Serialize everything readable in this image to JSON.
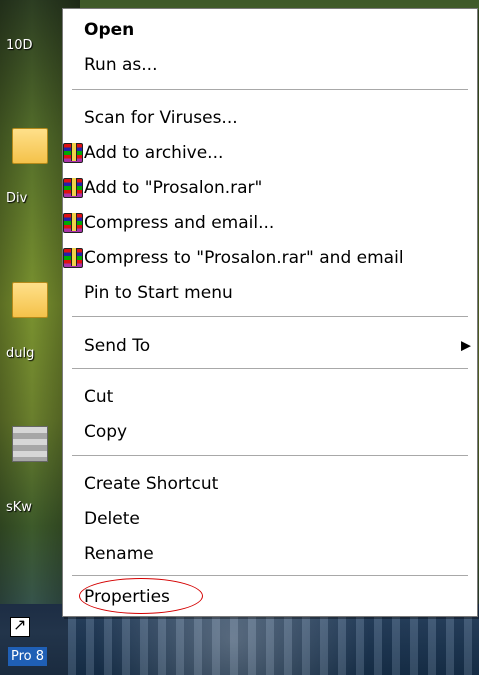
{
  "desktop": {
    "labels": [
      "10D",
      "Div",
      "dulg",
      "sKw",
      "Pro 8"
    ]
  },
  "context_menu": {
    "items": [
      {
        "label": "Open",
        "bold": true
      },
      {
        "label": "Run as..."
      },
      {
        "label": "Scan for Viruses..."
      },
      {
        "label": "Add to archive...",
        "icon": "winrar-icon"
      },
      {
        "label": "Add to \"Prosalon.rar\"",
        "icon": "winrar-icon"
      },
      {
        "label": "Compress and email...",
        "icon": "winrar-icon"
      },
      {
        "label": "Compress to \"Prosalon.rar\" and email",
        "icon": "winrar-icon"
      },
      {
        "label": "Pin to Start menu"
      },
      {
        "label": "Send To",
        "submenu": true
      },
      {
        "label": "Cut"
      },
      {
        "label": "Copy"
      },
      {
        "label": "Create Shortcut"
      },
      {
        "label": "Delete"
      },
      {
        "label": "Rename"
      },
      {
        "label": "Properties",
        "highlight": "red-ellipse"
      }
    ],
    "submenu_arrow_icon": "▶"
  }
}
